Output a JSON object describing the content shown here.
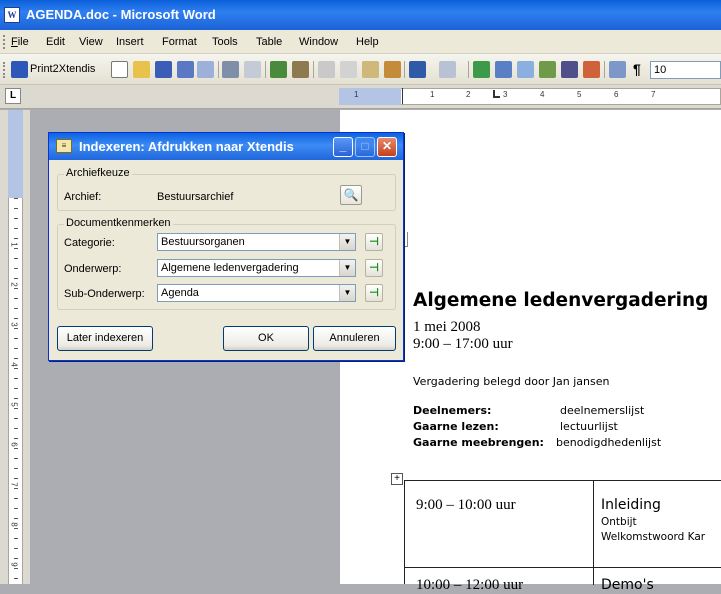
{
  "window": {
    "title": "AGENDA.doc - Microsoft Word",
    "app_icon": "W"
  },
  "menu": [
    "File",
    "Edit",
    "View",
    "Insert",
    "Format",
    "Tools",
    "Table",
    "Window",
    "Help"
  ],
  "toolbar": {
    "plugin_label": "Print2Xtendis",
    "zoom_value": "10"
  },
  "ruler": {
    "tab_selector": "L",
    "hnums": [
      "1",
      "1",
      "2",
      "3",
      "4",
      "5",
      "6",
      "7"
    ],
    "vnums": [
      "1",
      "1",
      "2",
      "3",
      "4",
      "5",
      "6",
      "7",
      "8",
      "9"
    ]
  },
  "dialog": {
    "title": "Indexeren: Afdrukken naar Xtendis",
    "archive_group": "Archiefkeuze",
    "archive_label": "Archief:",
    "archive_value": "Bestuursarchief",
    "doc_group": "Documentkenmerken",
    "category_label": "Categorie:",
    "category_value": "Bestuursorganen",
    "subject_label": "Onderwerp:",
    "subject_value": "Algemene ledenvergadering",
    "subsubject_label": "Sub-Onderwerp:",
    "subsubject_value": "Agenda",
    "later_button": "Later indexeren",
    "ok_button": "OK",
    "cancel_button": "Annuleren"
  },
  "document": {
    "heading": "Algemene ledenvergadering",
    "date": "1 mei 2008",
    "time": "9:00 – 17:00 uur",
    "organized_by": "Vergadering belegd door Jan jansen",
    "participants_label": "Deelnemers:",
    "participants_value": "deelnemerslijst",
    "reading_label": "Gaarne lezen:",
    "reading_value": "lectuurlijst",
    "bring_label": "Gaarne meebrengen:",
    "bring_value": "benodigdhedenlijst",
    "table": [
      {
        "time": "9:00 – 10:00 uur",
        "title": "Inleiding",
        "items": [
          "Ontbijt",
          "Welkomstwoord Kar"
        ]
      },
      {
        "time": "10:00 – 12:00 uur",
        "title": "Demo's",
        "items": []
      }
    ]
  }
}
